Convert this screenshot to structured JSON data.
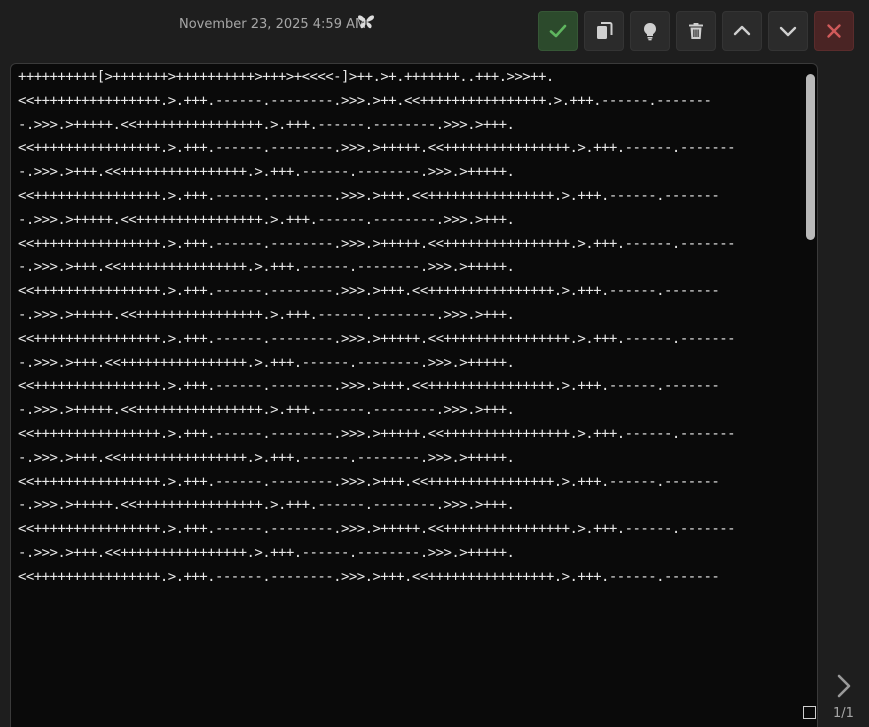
{
  "header": {
    "timestamp": "November 23, 2025 4:59 AM"
  },
  "toolbar": {
    "buttons": [
      {
        "name": "approve-button",
        "icon": "check-icon"
      },
      {
        "name": "copy-button",
        "icon": "copy-icon"
      },
      {
        "name": "hint-button",
        "icon": "lightbulb-icon"
      },
      {
        "name": "delete-button",
        "icon": "trash-icon"
      },
      {
        "name": "previous-button",
        "icon": "chevron-up-icon"
      },
      {
        "name": "next-item-button",
        "icon": "chevron-down-icon"
      },
      {
        "name": "close-button",
        "icon": "close-icon"
      }
    ]
  },
  "editor": {
    "lines": [
      "++++++++++[>+++++++>++++++++++>+++>+<<<<-]>++.>+.+++++++..+++.>>>++.",
      "<<++++++++++++++++.>.+++.------.--------.>>>.>++.<<++++++++++++++++.>.+++.------.-------",
      "-.>>>.>+++++.<<++++++++++++++++.>.+++.------.--------.>>>.>+++.",
      "<<++++++++++++++++.>.+++.------.--------.>>>.>+++++.<<++++++++++++++++.>.+++.------.-------",
      "-.>>>.>+++.<<++++++++++++++++.>.+++.------.--------.>>>.>+++++.",
      "<<++++++++++++++++.>.+++.------.--------.>>>.>+++.<<++++++++++++++++.>.+++.------.-------",
      "-.>>>.>+++++.<<++++++++++++++++.>.+++.------.--------.>>>.>+++.",
      "<<++++++++++++++++.>.+++.------.--------.>>>.>+++++.<<++++++++++++++++.>.+++.------.-------",
      "-.>>>.>+++.<<++++++++++++++++.>.+++.------.--------.>>>.>+++++.",
      "<<++++++++++++++++.>.+++.------.--------.>>>.>+++.<<++++++++++++++++.>.+++.------.-------",
      "-.>>>.>+++++.<<++++++++++++++++.>.+++.------.--------.>>>.>+++.",
      "<<++++++++++++++++.>.+++.------.--------.>>>.>+++++.<<++++++++++++++++.>.+++.------.-------",
      "-.>>>.>+++.<<++++++++++++++++.>.+++.------.--------.>>>.>+++++.",
      "<<++++++++++++++++.>.+++.------.--------.>>>.>+++.<<++++++++++++++++.>.+++.------.-------",
      "-.>>>.>+++++.<<++++++++++++++++.>.+++.------.--------.>>>.>+++.",
      "<<++++++++++++++++.>.+++.------.--------.>>>.>+++++.<<++++++++++++++++.>.+++.------.-------",
      "-.>>>.>+++.<<++++++++++++++++.>.+++.------.--------.>>>.>+++++.",
      "<<++++++++++++++++.>.+++.------.--------.>>>.>+++.<<++++++++++++++++.>.+++.------.-------",
      "-.>>>.>+++++.<<++++++++++++++++.>.+++.------.--------.>>>.>+++.",
      "<<++++++++++++++++.>.+++.------.--------.>>>.>+++++.<<++++++++++++++++.>.+++.------.-------",
      "-.>>>.>+++.<<++++++++++++++++.>.+++.------.--------.>>>.>+++++.",
      "<<++++++++++++++++.>.+++.------.--------.>>>.>+++.<<++++++++++++++++.>.+++.------.-------"
    ]
  },
  "pager": {
    "label": "1/1"
  },
  "colors": {
    "approve_icon": "#5fb65f",
    "close_icon": "#d05a5a",
    "icon_default": "#cfcfcf",
    "editor_background": "#0a0a0a",
    "app_background": "#1e1e1e"
  }
}
